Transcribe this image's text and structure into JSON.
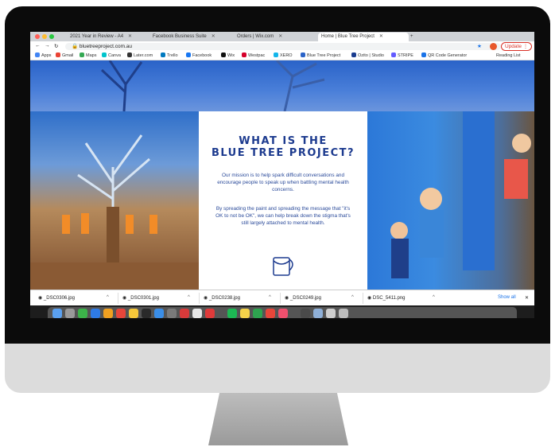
{
  "browser": {
    "tabs": [
      {
        "label": "2021 Year in Review - A4"
      },
      {
        "label": "Facebook Business Suite"
      },
      {
        "label": "Orders | Wix.com"
      },
      {
        "label": "Home | Blue Tree Project"
      }
    ],
    "url": "bluetreeproject.com.au",
    "update_label": "Update",
    "bookmarks": [
      {
        "label": "Apps",
        "color": "#4285f4"
      },
      {
        "label": "Gmail",
        "color": "#ea4335"
      },
      {
        "label": "Maps",
        "color": "#34a853"
      },
      {
        "label": "Canva",
        "color": "#00c4cc"
      },
      {
        "label": "Later.com",
        "color": "#333333"
      },
      {
        "label": "Trello",
        "color": "#0079bf"
      },
      {
        "label": "Facebook",
        "color": "#1877f2"
      },
      {
        "label": "Wix",
        "color": "#111111"
      },
      {
        "label": "Westpac",
        "color": "#d5002b"
      },
      {
        "label": "XERO",
        "color": "#13b5ea"
      },
      {
        "label": "Blue Tree Project",
        "color": "#2a63c8"
      },
      {
        "label": "Ozito | Studio",
        "color": "#1a3c8f"
      },
      {
        "label": "STRIPE",
        "color": "#635bff"
      },
      {
        "label": "QR Code Generator",
        "color": "#1a73e8"
      }
    ],
    "reading_list": "Reading List"
  },
  "site": {
    "heading_line1": "WHAT IS THE",
    "heading_line2": "BLUE TREE PROJECT?",
    "paragraph1": "Our mission is to help spark difficult conversations and encourage people to speak up when battling mental health concerns.",
    "paragraph2": "By spreading the paint and spreading the message that \"it's OK to not be OK\", we can help break down the stigma that's still largely attached to mental health.",
    "brand_blue": "#1d3b8f"
  },
  "downloads": {
    "files": [
      "_DSC0306.jpg",
      "_DSC0301.jpg",
      "_DSC0238.jpg",
      "_DSC0249.jpg",
      "DSC_5411.png"
    ],
    "show_all": "Show all"
  }
}
